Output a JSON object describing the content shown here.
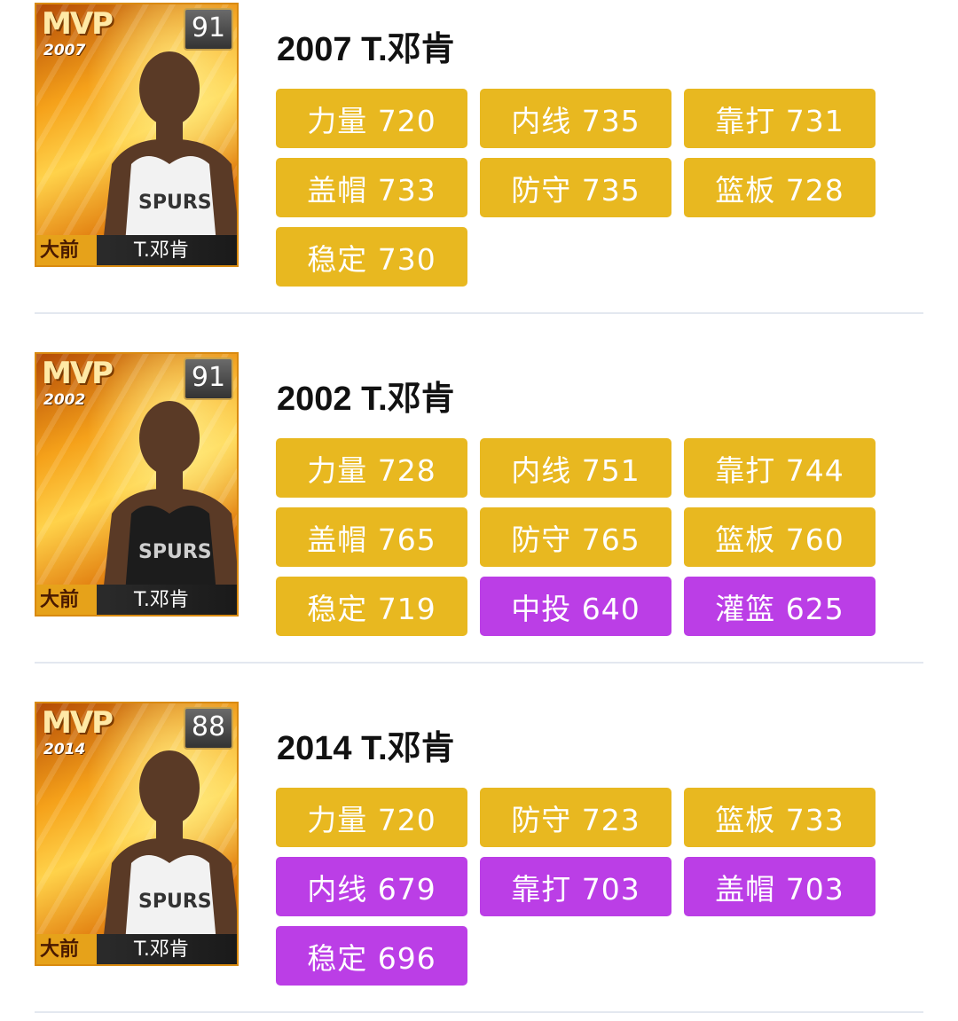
{
  "cards": [
    {
      "mvp": "MVP",
      "year": "2007",
      "rating": "91",
      "position": "大前",
      "name": "T.邓肯",
      "title": "2007 T.邓肯",
      "jersey": "white",
      "attributes": [
        {
          "label": "力量 720",
          "color": "gold"
        },
        {
          "label": "内线 735",
          "color": "gold"
        },
        {
          "label": "靠打 731",
          "color": "gold"
        },
        {
          "label": "盖帽 733",
          "color": "gold"
        },
        {
          "label": "防守 735",
          "color": "gold"
        },
        {
          "label": "篮板 728",
          "color": "gold"
        },
        {
          "label": "稳定 730",
          "color": "gold"
        }
      ]
    },
    {
      "mvp": "MVP",
      "year": "2002",
      "rating": "91",
      "position": "大前",
      "name": "T.邓肯",
      "title": "2002 T.邓肯",
      "jersey": "black",
      "attributes": [
        {
          "label": "力量 728",
          "color": "gold"
        },
        {
          "label": "内线 751",
          "color": "gold"
        },
        {
          "label": "靠打 744",
          "color": "gold"
        },
        {
          "label": "盖帽 765",
          "color": "gold"
        },
        {
          "label": "防守 765",
          "color": "gold"
        },
        {
          "label": "篮板 760",
          "color": "gold"
        },
        {
          "label": "稳定 719",
          "color": "gold"
        },
        {
          "label": "中投 640",
          "color": "purple"
        },
        {
          "label": "灌篮 625",
          "color": "purple"
        }
      ]
    },
    {
      "mvp": "MVP",
      "year": "2014",
      "rating": "88",
      "position": "大前",
      "name": "T.邓肯",
      "title": "2014 T.邓肯",
      "jersey": "white",
      "attributes": [
        {
          "label": "力量 720",
          "color": "gold"
        },
        {
          "label": "防守 723",
          "color": "gold"
        },
        {
          "label": "篮板 733",
          "color": "gold"
        },
        {
          "label": "内线 679",
          "color": "purple"
        },
        {
          "label": "靠打 703",
          "color": "purple"
        },
        {
          "label": "盖帽 703",
          "color": "purple"
        },
        {
          "label": "稳定 696",
          "color": "purple"
        }
      ]
    }
  ],
  "colors": {
    "gold": "#e8b820",
    "purple": "#bb3ee6"
  }
}
